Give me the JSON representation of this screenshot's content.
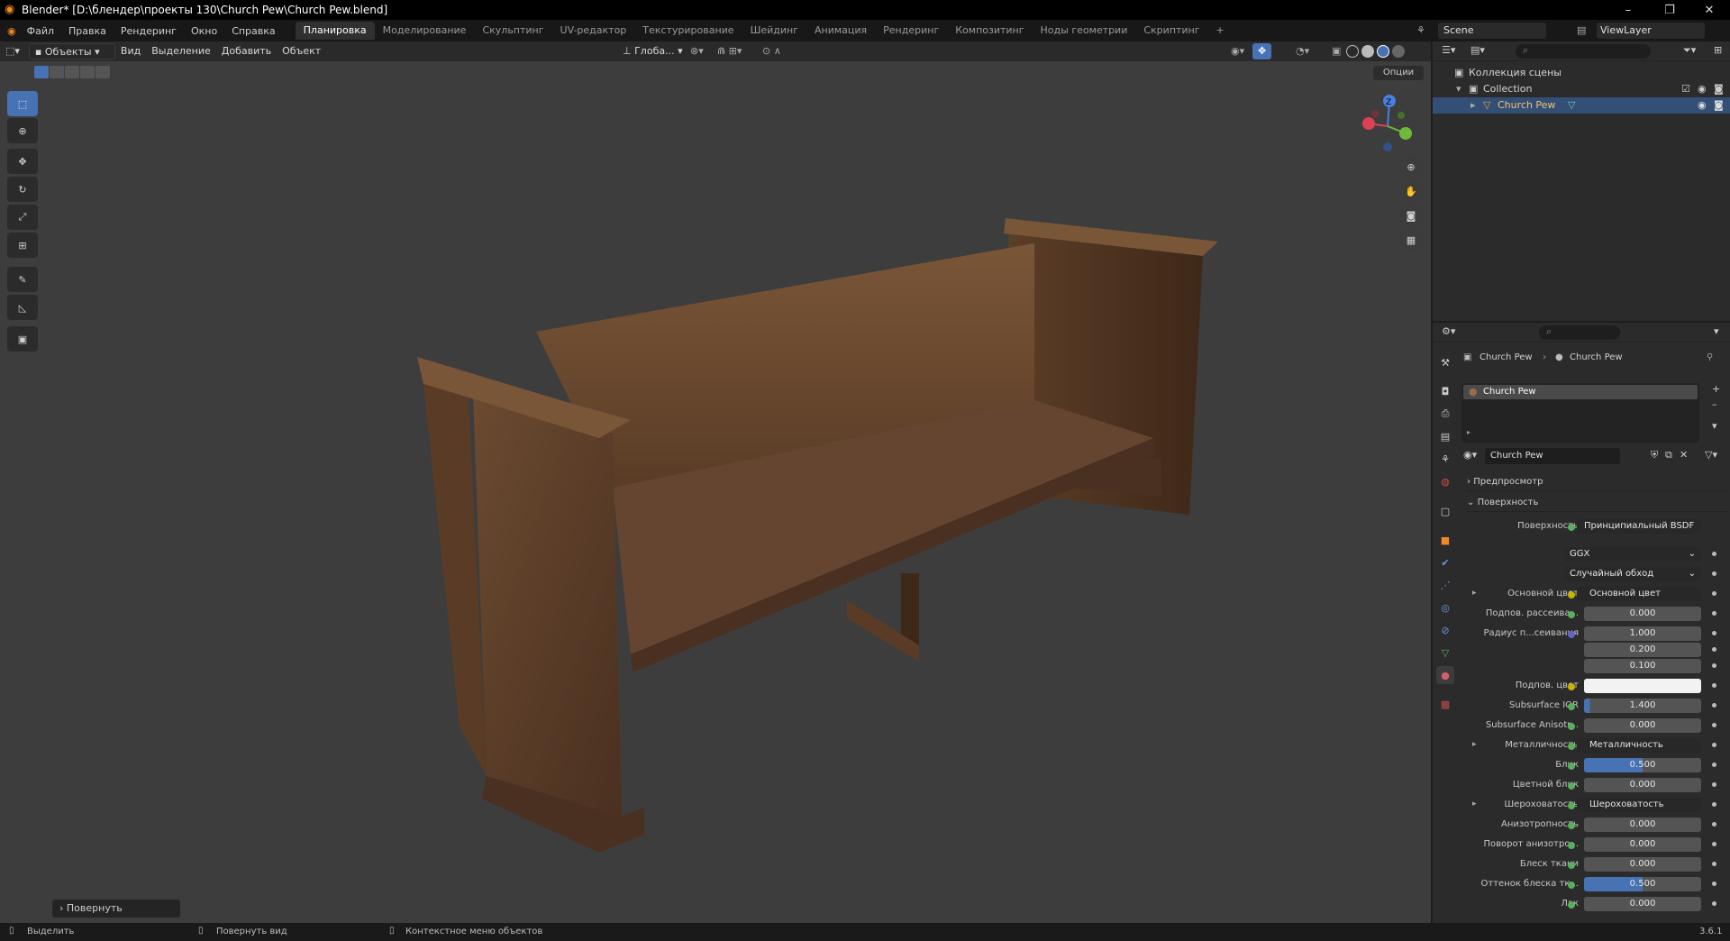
{
  "window": {
    "title": "Blender* [D:\\блендер\\проекты 130\\Church Pew\\Church Pew.blend]"
  },
  "menubar": {
    "menus": [
      "Файл",
      "Правка",
      "Рендеринг",
      "Окно",
      "Справка"
    ],
    "workspaces": [
      "Планировка",
      "Моделирование",
      "Скульптинг",
      "UV-редактор",
      "Текстурирование",
      "Шейдинг",
      "Анимация",
      "Рендеринг",
      "Композитинг",
      "Ноды геометрии",
      "Скриптинг"
    ],
    "active_workspace": "Планировка",
    "add_tab": "+",
    "scene": "Scene",
    "view_layer": "ViewLayer"
  },
  "viewport": {
    "mode": "Объекты",
    "menus": [
      "Вид",
      "Выделение",
      "Добавить",
      "Объект"
    ],
    "transform_orientation": "Глоба...",
    "options_label": "Опции",
    "redo_panel_label": "Повернуть",
    "gizmo": {
      "z": "Z"
    }
  },
  "outliner": {
    "root": "Коллекция сцены",
    "collection": "Collection",
    "object": "Church Pew"
  },
  "properties": {
    "breadcrumb_object": "Church Pew",
    "breadcrumb_material": "Church Pew",
    "material_slot": "Church Pew",
    "material_name": "Church Pew",
    "preview_panel": "Предпросмотр",
    "surface_panel": "Поверхность",
    "surface_label": "Поверхность",
    "surface_shader": "Принципиальный BSDF",
    "distribution": "GGX",
    "subsurface_method": "Случайный обход",
    "rows": [
      {
        "label": "Основной цвет",
        "value": "Основной цвет",
        "kind": "link",
        "dot": "y",
        "expand": true
      },
      {
        "label": "Подпов. рассеива...",
        "value": "0.000",
        "kind": "num",
        "dot": "g"
      },
      {
        "label": "Радиус п...сеивания",
        "value": "1.000",
        "kind": "num",
        "dot": "b"
      },
      {
        "label": "",
        "value": "0.200",
        "kind": "num",
        "dot": ""
      },
      {
        "label": "",
        "value": "0.100",
        "kind": "num",
        "dot": ""
      },
      {
        "label": "Подпов. цвет",
        "value": "",
        "kind": "color",
        "dot": "y"
      },
      {
        "label": "Subsurface IOR",
        "value": "1.400",
        "kind": "num",
        "dot": "g",
        "fill": 0.05
      },
      {
        "label": "Subsurface Anisotr...",
        "value": "0.000",
        "kind": "num",
        "dot": "g"
      },
      {
        "label": "Металличность",
        "value": "Металличность",
        "kind": "link",
        "dot": "g",
        "expand": true
      },
      {
        "label": "Блик",
        "value": "0.500",
        "kind": "num",
        "dot": "g",
        "fill": 0.5
      },
      {
        "label": "Цветной блик",
        "value": "0.000",
        "kind": "num",
        "dot": "g"
      },
      {
        "label": "Шероховатость",
        "value": "Шероховатость",
        "kind": "link",
        "dot": "g",
        "expand": true
      },
      {
        "label": "Анизотропность",
        "value": "0.000",
        "kind": "num",
        "dot": "g"
      },
      {
        "label": "Поворот анизотро...",
        "value": "0.000",
        "kind": "num",
        "dot": "g"
      },
      {
        "label": "Блеск ткани",
        "value": "0.000",
        "kind": "num",
        "dot": "g"
      },
      {
        "label": "Оттенок блеска тк...",
        "value": "0.500",
        "kind": "num",
        "dot": "g",
        "fill": 0.5
      },
      {
        "label": "Лак",
        "value": "0.000",
        "kind": "num",
        "dot": "g"
      }
    ]
  },
  "statusbar": {
    "select": "Выделить",
    "rotate_view": "Повернуть вид",
    "context_menu": "Контекстное меню объектов",
    "version": "3.6.1"
  }
}
